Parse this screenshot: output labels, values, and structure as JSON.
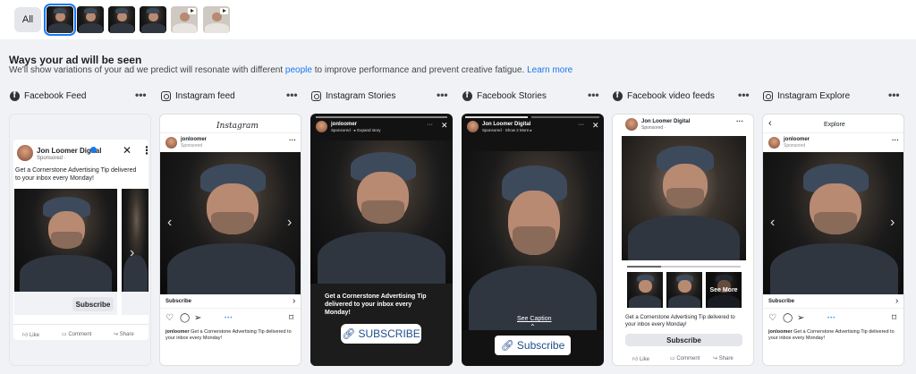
{
  "filter": {
    "all_label": "All",
    "thumbnails": [
      {
        "name": "creative-1",
        "selected": true,
        "video": false
      },
      {
        "name": "creative-2",
        "selected": false,
        "video": false
      },
      {
        "name": "creative-3",
        "selected": false,
        "video": false
      },
      {
        "name": "creative-4",
        "selected": false,
        "video": false
      },
      {
        "name": "creative-5",
        "selected": false,
        "video": true
      },
      {
        "name": "creative-6",
        "selected": false,
        "video": true
      }
    ]
  },
  "ways": {
    "title": "Ways your ad will be seen",
    "desc_prefix": "We'll show variations of your ad we predict will resonate with different",
    "desc_link_people": "people",
    "desc_suffix": "to improve performance and prevent creative fatigue.",
    "learn_more": "Learn more"
  },
  "placements": [
    {
      "label": "Facebook Feed",
      "icon": "facebook-icon"
    },
    {
      "label": "Instagram feed",
      "icon": "instagram-icon"
    },
    {
      "label": "Instagram Stories",
      "icon": "instagram-icon"
    },
    {
      "label": "Facebook Stories",
      "icon": "facebook-icon"
    },
    {
      "label": "Facebook video feeds",
      "icon": "facebook-icon"
    },
    {
      "label": "Instagram Explore",
      "icon": "instagram-icon"
    }
  ],
  "more_menu": "•••",
  "fb_feed": {
    "page_name": "Jon Loomer Digital",
    "sponsored": "Sponsored · ",
    "primary_text": "Get a Cornerstone Advertising Tip delivered to your inbox every Monday!",
    "cta": "Subscribe",
    "actions": [
      "Like",
      "Comment",
      "Share"
    ]
  },
  "ig_feed": {
    "logo": "Instagram",
    "handle": "jonloomer",
    "sponsored": "Sponsored",
    "cta": "Subscribe",
    "caption_handle": "jonloomer",
    "caption": " Get a Cornerstone Advertising Tip delivered to your inbox every Monday!"
  },
  "ig_stories": {
    "handle": "jonloomer",
    "meta": "Sponsored · ▸ Expand story",
    "text": "Get a Cornerstone Advertising Tip delivered to your inbox every Monday!",
    "cta": "SUBSCRIBE"
  },
  "fb_stories": {
    "page_name": "Jon Loomer Digital",
    "meta": "Sponsored · Show 2 More ▸",
    "see_caption": "See Caption",
    "cta": "Subscribe"
  },
  "fb_video": {
    "page_name": "Jon Loomer Digital",
    "sponsored": "Sponsored · ",
    "see_more": "See More",
    "text": "Get a Cornerstone Advertising Tip delivered to your inbox every Monday!",
    "cta": "Subscribe",
    "actions": [
      "Like",
      "Comment",
      "Share"
    ]
  },
  "ig_explore": {
    "header": "Explore",
    "handle": "jonloomer",
    "sponsored": "Sponsored",
    "cta": "Subscribe",
    "caption_handle": "jonloomer",
    "caption": " Get a Cornerstone Advertising Tip delivered to your inbox every Monday!"
  },
  "colors": {
    "accent": "#1877f2",
    "page_bg": "#f0f2f5"
  }
}
